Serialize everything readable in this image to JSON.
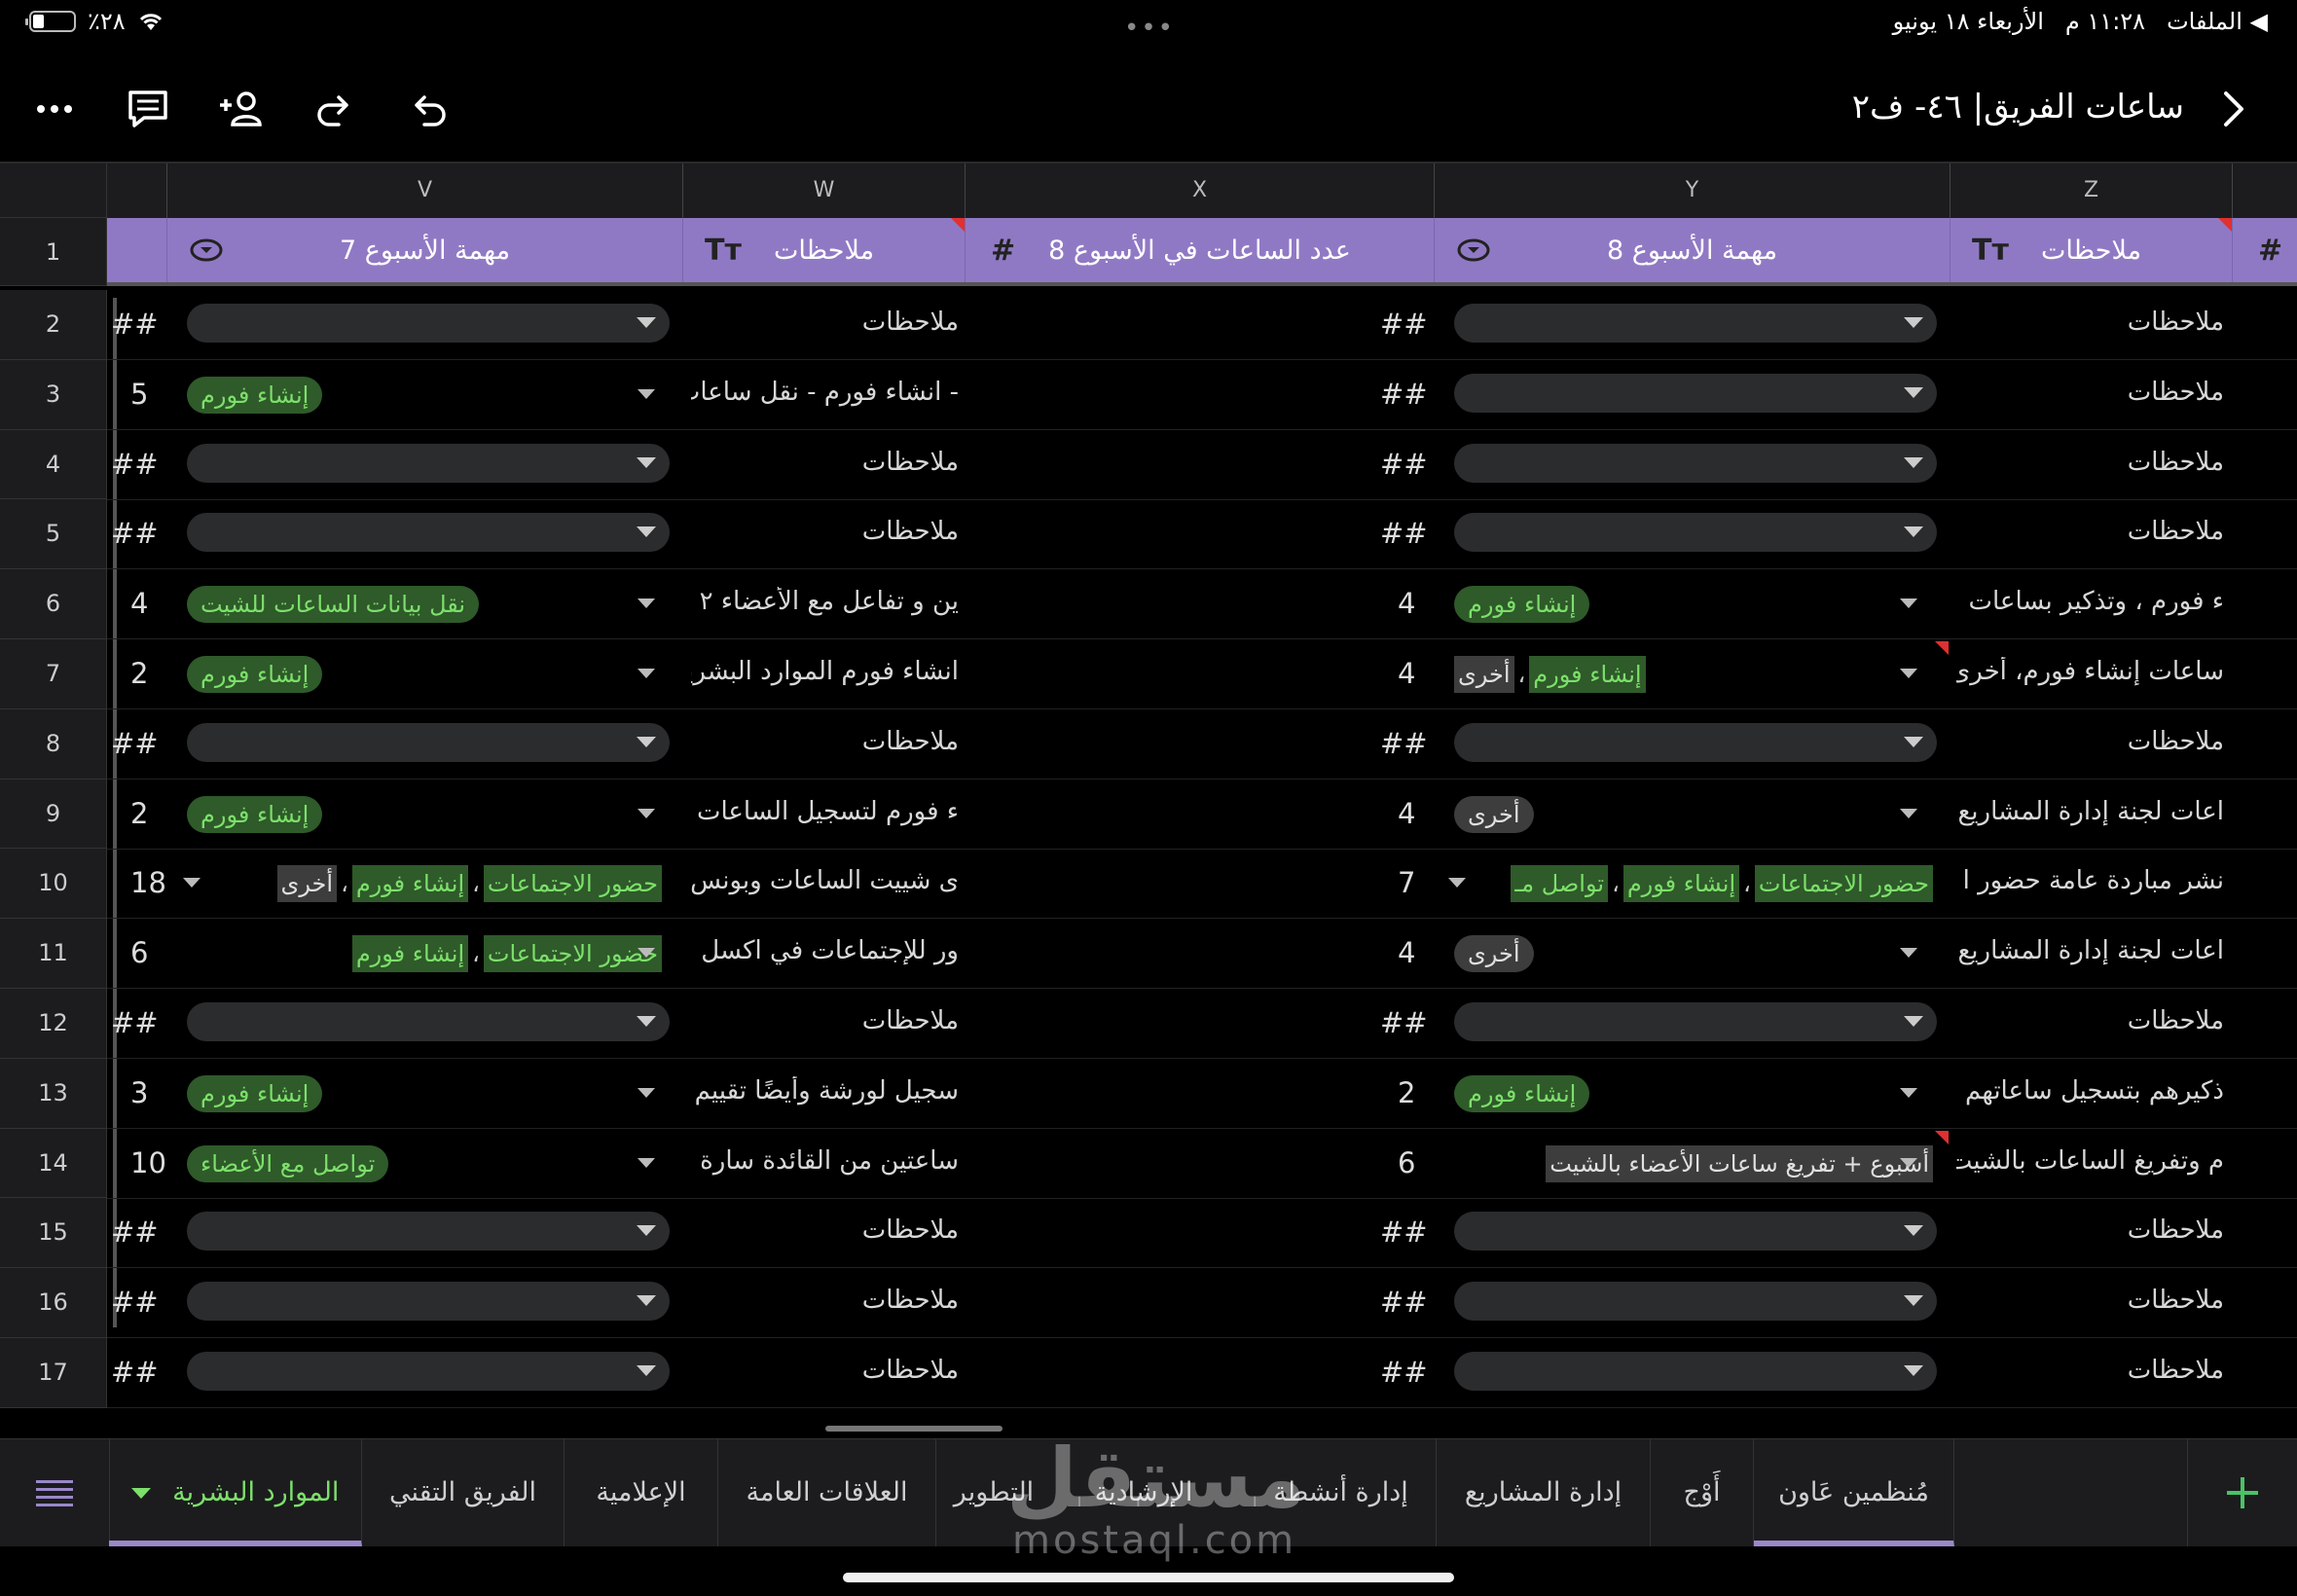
{
  "status_bar": {
    "files_app": "◀ الملفات",
    "time": "١١:٢٨ م",
    "date": "الأربعاء ١٨ يونيو",
    "battery": "٪٢٨"
  },
  "toolbar": {
    "title": "ساعات الفريق| ٤٦- ف٢"
  },
  "columns": [
    "V",
    "W",
    "X",
    "Y",
    "Z"
  ],
  "header": {
    "week7_task": "مهمة الأسبوع 7",
    "notes_w": "ملاحظات",
    "week8_hours": "عدد الساعات في الأسبوع 8",
    "week8_task": "مهمة الأسبوع 8",
    "notes_z": "ملاحظات",
    "hash": "#",
    "text_icon": "Tт"
  },
  "rows": [
    {
      "n": "2",
      "v_num": "##",
      "v_tags": [],
      "w": "ملاحظات",
      "x": "##",
      "y_tags": [],
      "z": "ملاحظات"
    },
    {
      "n": "3",
      "v_num": "5",
      "v_tags": [
        "إنشاء فورم"
      ],
      "w": "- انشاء فورم - نقل ساعات",
      "x": "##",
      "y_tags": [],
      "z": "ملاحظات"
    },
    {
      "n": "4",
      "v_num": "##",
      "v_tags": [],
      "w": "ملاحظات",
      "x": "##",
      "y_tags": [],
      "z": "ملاحظات"
    },
    {
      "n": "5",
      "v_num": "##",
      "v_tags": [],
      "w": "ملاحظات",
      "x": "##",
      "y_tags": [],
      "z": "ملاحظات"
    },
    {
      "n": "6",
      "v_num": "4",
      "v_tags": [
        "نقل بيانات الساعات للشيت"
      ],
      "w": "ين و تفاعل مع الأعضاء ٢",
      "x": "4",
      "y_tags": [
        "إنشاء فورم"
      ],
      "z": "ء فورم ، وتذكير بساعات"
    },
    {
      "n": "7",
      "v_num": "2",
      "v_tags": [
        "إنشاء فورم"
      ],
      "w": "انشاء فورم الموارد البشريه",
      "x": "4",
      "y_multi": [
        [
          "إنشاء فورم",
          "g"
        ],
        [
          "أخرى",
          "o"
        ]
      ],
      "z": "ساعات إنشاء فورم، أخرى"
    },
    {
      "n": "8",
      "v_num": "##",
      "v_tags": [],
      "w": "ملاحظات",
      "x": "##",
      "y_tags": [],
      "z": "ملاحظات"
    },
    {
      "n": "9",
      "v_num": "2",
      "v_tags": [
        "إنشاء فورم"
      ],
      "w": "ء فورم لتسجيل الساعات",
      "x": "4",
      "y_tags": [
        "أخرى"
      ],
      "z": "اعات لجنة إدارة المشاريع"
    },
    {
      "n": "10",
      "v_num": "18",
      "v_multi": [
        [
          "حضور الاجتماعات",
          "g"
        ],
        [
          "إنشاء فورم",
          "g"
        ],
        [
          "أخرى",
          "o"
        ]
      ],
      "w": "ى شييت الساعات وبونس",
      "x": "7",
      "y_multi": [
        [
          "حضور الاجتماعات",
          "g"
        ],
        [
          "إنشاء فورم",
          "g"
        ],
        [
          "تواصل مـ",
          "g"
        ]
      ],
      "z": "نشر مباردة عامة حضور ا"
    },
    {
      "n": "11",
      "v_num": "6",
      "v_multi": [
        [
          "حضور الاجتماعات",
          "g"
        ],
        [
          "إنشاء فورم",
          "g"
        ]
      ],
      "w": "ور للإجتماعات في اكسل",
      "x": "4",
      "y_tags": [
        "أخرى"
      ],
      "z": "اعات لجنة إدارة المشاريع"
    },
    {
      "n": "12",
      "v_num": "##",
      "v_tags": [],
      "w": "ملاحظات",
      "x": "##",
      "y_tags": [],
      "z": "ملاحظات"
    },
    {
      "n": "13",
      "v_num": "3",
      "v_tags": [
        "إنشاء فورم"
      ],
      "w": "سجيل لورشة وأيضًا تقييم",
      "x": "2",
      "y_tags": [
        "إنشاء فورم"
      ],
      "z": "ذكيرهم بتسجيل ساعاتهم"
    },
    {
      "n": "14",
      "v_num": "10",
      "v_tags": [
        "تواصل مع الأعضاء"
      ],
      "w": "ساعتين من القائدة سارة",
      "x": "6",
      "y_multi": [
        [
          "أسبوع + تفريغ ساعات الأعضاء بالشيت",
          "o"
        ]
      ],
      "z": "م وتفريغ الساعات بالشيت"
    },
    {
      "n": "15",
      "v_num": "##",
      "v_tags": [],
      "w": "ملاحظات",
      "x": "##",
      "y_tags": [],
      "z": "ملاحظات"
    },
    {
      "n": "16",
      "v_num": "##",
      "v_tags": [],
      "w": "ملاحظات",
      "x": "##",
      "y_tags": [],
      "z": "ملاحظات"
    },
    {
      "n": "17",
      "v_num": "##",
      "v_tags": [],
      "w": "ملاحظات",
      "x": "##",
      "y_tags": [],
      "z": "ملاحظات"
    }
  ],
  "tabs": [
    {
      "label": "مُنظمين عَاون"
    },
    {
      "label": "أَوْج"
    },
    {
      "label": "إدارة المشاريع"
    },
    {
      "label": "إدارة أنشطة"
    },
    {
      "label": "الإرشادية"
    },
    {
      "label": "التطوير"
    },
    {
      "label": "العلاقات العامة"
    },
    {
      "label": "الإعلامية"
    },
    {
      "label": "الفريق التقني"
    },
    {
      "label": "الموارد البشرية"
    }
  ],
  "watermark": {
    "main": "مستقل",
    "sub": "mostaql.com"
  },
  "colors": {
    "header": "#9079c4",
    "chip_bg": "#2f5a2a",
    "chip_text": "#7ce06a",
    "add": "#49c265"
  }
}
